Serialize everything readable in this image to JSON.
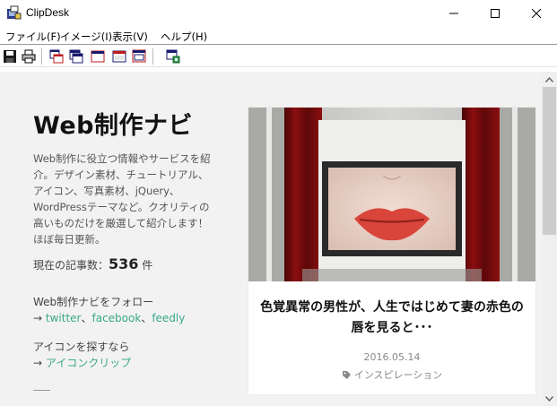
{
  "window": {
    "title": "ClipDesk"
  },
  "menu": {
    "items": [
      {
        "label": "ファイル(F)"
      },
      {
        "label": "イメージ(I)"
      },
      {
        "label": "表示(V)"
      },
      {
        "label": "ヘルプ(H)"
      }
    ]
  },
  "toolbar": {
    "icons": [
      "save-icon",
      "print-icon",
      "window-icon",
      "window-icon",
      "window-icon",
      "window-icon",
      "window-icon",
      "capture-icon"
    ]
  },
  "site": {
    "title": "Web制作ナビ",
    "description": "Web制作に役立つ情報やサービスを紹介。デザイン素材、チュートリアル、アイコン、写真素材、jQuery、WordPressテーマなど。クオリティの高いものだけを厳選して紹介します！ほぼ毎日更新。",
    "count_label": "現在の記事数：",
    "count_value": "536",
    "count_unit": "件",
    "follow_heading": "Web制作ナビをフォロー",
    "arrow": "→",
    "sep": "、",
    "follow_twitter": "twitter",
    "follow_facebook": "facebook",
    "follow_feedly": "feedly",
    "icon_heading": "アイコンを探すなら",
    "icon_link": "アイコンクリップ"
  },
  "card": {
    "title": "色覚異常の男性が、人生ではじめて妻の赤色の唇を見ると･･･",
    "date": "2016.05.14",
    "category": "インスピレーション"
  },
  "colors": {
    "link": "#3aa88a",
    "content_bg": "#f2f2f2",
    "curtain": "#8b0f10",
    "lips": "#d9453a"
  }
}
